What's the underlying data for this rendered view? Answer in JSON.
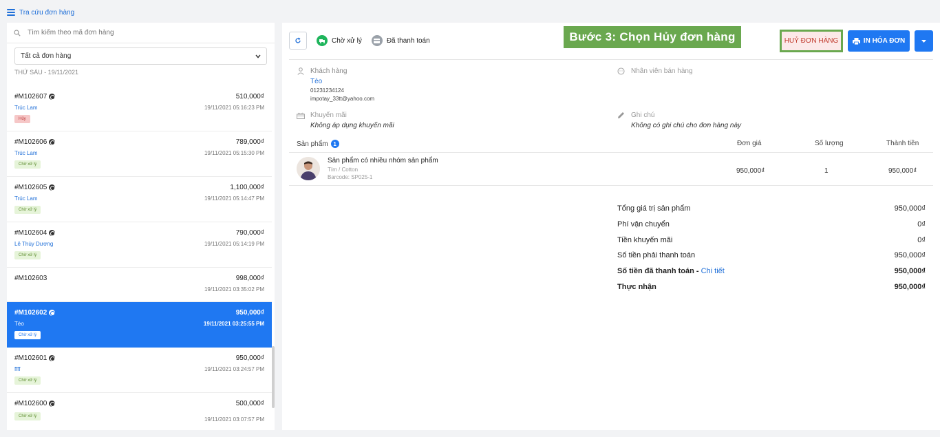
{
  "app": {
    "title": "Tra cứu đơn hàng"
  },
  "left": {
    "search_placeholder": "Tìm kiếm theo mã đơn hàng",
    "filter_value": "Tất cả đơn hàng",
    "date_group": "THỨ SÁU - 19/11/2021",
    "orders": [
      {
        "code": "#M102607",
        "price": "510,000₫",
        "customer": "Trúc Lam",
        "time": "19/11/2021 05:16:23 PM",
        "badge": "Hủy",
        "badge_type": "cancel"
      },
      {
        "code": "#M102606",
        "price": "789,000₫",
        "customer": "Trúc Lam",
        "time": "19/11/2021 05:15:30 PM",
        "badge": "Chờ xử lý",
        "badge_type": "pending"
      },
      {
        "code": "#M102605",
        "price": "1,100,000₫",
        "customer": "Trúc Lam",
        "time": "19/11/2021 05:14:47 PM",
        "badge": "Chờ xử lý",
        "badge_type": "pending"
      },
      {
        "code": "#M102604",
        "price": "790,000₫",
        "customer": "Lê Thùy Dương",
        "time": "19/11/2021 05:14:19 PM",
        "badge": "Chờ xử lý",
        "badge_type": "pending"
      },
      {
        "code": "#M102603",
        "price": "998,000₫",
        "customer": "",
        "time": "19/11/2021 03:35:02 PM",
        "badge": "",
        "badge_type": ""
      },
      {
        "code": "#M102602",
        "price": "950,000₫",
        "customer": "Tèo",
        "time": "19/11/2021 03:25:55 PM",
        "badge": "Chờ xử lý",
        "badge_type": "white",
        "active": true
      },
      {
        "code": "#M102601",
        "price": "950,000₫",
        "customer": "ffff",
        "time": "19/11/2021 03:24:57 PM",
        "badge": "Chờ xử lý",
        "badge_type": "pending"
      },
      {
        "code": "#M102600",
        "price": "500,000₫",
        "customer": "",
        "time": "19/11/2021 03:07:57 PM",
        "badge": "Chờ xử lý",
        "badge_type": "pending"
      }
    ]
  },
  "toolbar": {
    "status_processing": "Chờ xử lý",
    "status_paid": "Đã thanh toán",
    "step_banner": "Bước 3: Chọn Hủy đơn hàng",
    "cancel_label": "HUỶ ĐƠN HÀNG",
    "print_label": "IN HÓA ĐƠN"
  },
  "details": {
    "customer_label": "Khách hàng",
    "customer_name": "Tèo",
    "customer_phone": "01231234124",
    "customer_email": "impotay_33tt@yahoo.com",
    "staff_label": "Nhân viên bán hàng",
    "promo_label": "Khuyến mãi",
    "promo_value": "Không áp dụng khuyến mãi",
    "note_label": "Ghi chú",
    "note_value": "Không có ghi chú cho đơn hàng này"
  },
  "products": {
    "headers": {
      "product": "Sản phẩm",
      "count": "1",
      "unit_price": "Đơn giá",
      "quantity": "Số lượng",
      "total": "Thành tiền"
    },
    "items": [
      {
        "name": "Sản phẩm có nhiều nhóm sản phẩm",
        "variant": "Tím / Cotton",
        "barcode": "Barcode: SP025-1",
        "unit_price": "950,000₫",
        "quantity": "1",
        "total": "950,000₫"
      }
    ]
  },
  "summary": {
    "subtotal_label": "Tổng giá trị sản phẩm",
    "subtotal": "950,000₫",
    "shipping_label": "Phí vận chuyển",
    "shipping": "0₫",
    "discount_label": "Tiền khuyến mãi",
    "discount": "0₫",
    "payable_label": "Số tiền phải thanh toán",
    "payable": "950,000₫",
    "paid_label": "Số tiền đã thanh toán - ",
    "paid_link": "Chi tiết",
    "paid": "950,000₫",
    "received_label": "Thực nhận",
    "received": "950,000₫"
  },
  "colors": {
    "primary": "#1f78f2",
    "banner": "#6aa84f",
    "cancel_text": "#c0392b",
    "pending_badge": "#e6f4d9",
    "cancel_badge": "#f6c7c7"
  }
}
